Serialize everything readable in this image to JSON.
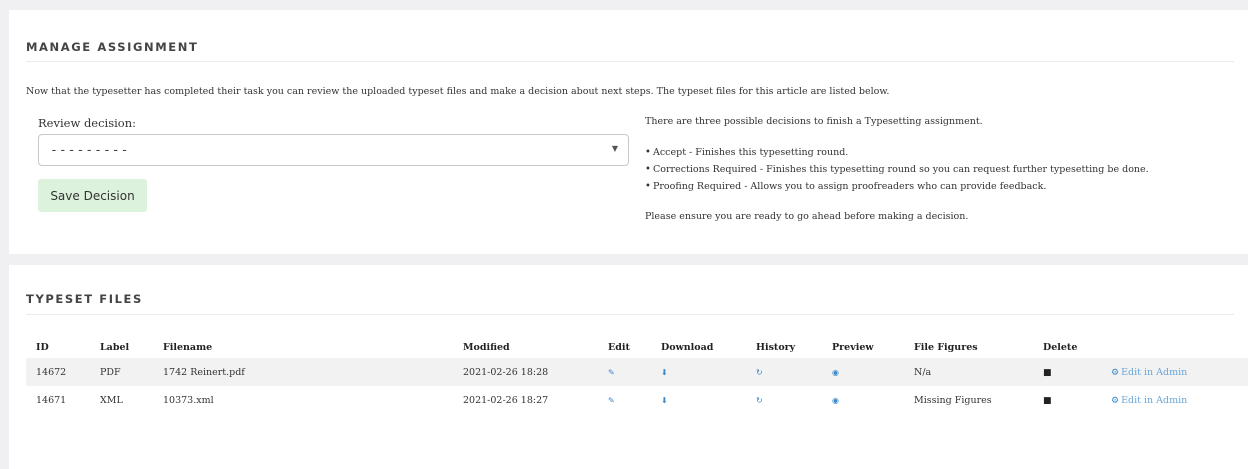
{
  "manage": {
    "title": "MANAGE ASSIGNMENT",
    "intro": "Now that the typesetter has completed their task you can review the uploaded typeset files and make a decision about next steps. The typeset files for this article are listed below.",
    "decision_label": "Review decision:",
    "decision_value": "---------",
    "save_label": "Save Decision",
    "right_intro": "There are three possible decisions to finish a Typesetting assignment.",
    "options": [
      "Accept - Finishes this typesetting round.",
      "Corrections Required - Finishes this typesetting round so you can request further typesetting be done.",
      "Proofing Required - Allows you to assign proofreaders who can provide feedback."
    ],
    "ensure": "Please ensure you are ready to go ahead before making a decision."
  },
  "files": {
    "title": "TYPESET FILES",
    "columns": [
      "ID",
      "Label",
      "Filename",
      "Modified",
      "Edit",
      "Download",
      "History",
      "Preview",
      "File Figures",
      "Delete",
      ""
    ],
    "rows": [
      {
        "id": "14672",
        "label": "PDF",
        "filename": "1742 Reinert.pdf",
        "modified": "2021-02-26 18:28",
        "figures": "N/a",
        "admin": "Edit in Admin"
      },
      {
        "id": "14671",
        "label": "XML",
        "filename": "10373.xml",
        "modified": "2021-02-26 18:27",
        "figures": "Missing Figures",
        "admin": "Edit in Admin"
      }
    ],
    "icons": {
      "edit": "edit-icon",
      "download": "download-icon",
      "history": "history-icon",
      "preview": "eye-icon",
      "delete": "trash-icon",
      "admin": "gears-icon"
    },
    "link_color": "#3a87ca"
  }
}
